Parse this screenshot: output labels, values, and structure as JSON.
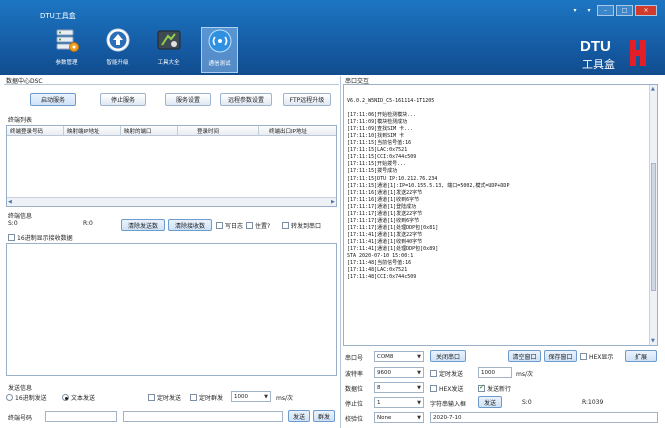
{
  "window": {
    "title": "DTU工具盒",
    "controls": [
      "▾",
      "▾",
      "–",
      "□",
      "×"
    ]
  },
  "nav": [
    {
      "label": "参数管理",
      "icon": "server-config-icon"
    },
    {
      "label": "智能升级",
      "icon": "upload-arrow-icon"
    },
    {
      "label": "工具大全",
      "icon": "toolbox-icon"
    },
    {
      "label": "通信测试",
      "icon": "signal-test-icon"
    }
  ],
  "logo": {
    "line1": "DTU",
    "line2": "工具盒"
  },
  "left": {
    "title": "数据中心DSC",
    "buttons": [
      "启动服务",
      "停止服务",
      "服务设置",
      "远程参数设置",
      "FTP远程升级"
    ],
    "list_title": "终端列表",
    "columns": [
      "终端登录号码",
      "映射端IP地址",
      "映射的端口",
      "登录时间",
      "终端出口IP地址"
    ],
    "info_title": "终端信息",
    "s_label": "S:0",
    "r_label": "R:0",
    "clear_send": "清除发送数",
    "clear_recv": "清除接收数",
    "opt_log": "写日志",
    "opt_top": "住置?",
    "opt_forward": "转发到串口",
    "opt_hex_recv": "16进制显示接收数据",
    "send_title": "发送信息",
    "radio_hex": "16进制发送",
    "radio_text": "文本发送",
    "opt_timed": "定时发送",
    "opt_timed_group": "定时群发",
    "interval": "1000",
    "interval_unit": "ms/次",
    "terminal_label": "终端号码",
    "send": "发送",
    "group_send": "群发"
  },
  "right": {
    "title": "串口交互",
    "log": [
      "V6.0.2_W5NID_C5-161114-1T1205",
      "",
      "[17:11:06]开始检测模块...",
      "[17:11:09]模块检测成功",
      "[17:11:09]查找SIM 卡...",
      "[17:11:10]找到SIM 卡",
      "[17:11:15]当前信号值:16",
      "[17:11:15]LAC:0x7521",
      "[17:11:15]CCI:0x744c509",
      "[17:11:15]开始拨号...",
      "[17:11:15]拨号成功",
      "[17:11:15]DTU IP:10.212.76.234",
      "[17:11:15]通道[1]:IP=10.155.5.13, 端口=5002,模式=UDP+DDP",
      "[17:11:16]通道[1]发送22字节",
      "[17:11:16]通道[1]收到6字节",
      "[17:11:17]通道[1]登陆成功",
      "[17:11:17]通道[1]发送22字节",
      "[17:11:17]通道[1]收到6字节",
      "[17:11:17]通道[1]处理DDP包[0x81]",
      "[17:11:41]通道[1]发送22字节",
      "[17:11:41]通道[1]收到40字节",
      "[17:11:41]通道[1]处理DDP包[0x89]",
      "STA 2020-07-10 15:00:1",
      "[17:11:48]当前信号值:16",
      "[17:11:48]LAC:0x7521",
      "[17:11:48]CCI:0x744c509"
    ],
    "port_label": "串口号",
    "port_value": "COM8",
    "close_port": "关闭串口",
    "clear_window": "清空窗口",
    "save_window": "保存窗口",
    "hex_display": "HEX显示",
    "expand": "扩展",
    "baud_label": "波特率",
    "baud_value": "9600",
    "timed_send": "定时发送",
    "timed_ms": "1000",
    "timed_unit": "ms/次",
    "data_bits_label": "数据位",
    "data_bits_value": "8",
    "hex_send": "HEX发送",
    "send_newline": "发送新行",
    "stop_bits_label": "停止位",
    "stop_bits_value": "1",
    "input_box": "字符串输入框",
    "send": "发送",
    "s_count": "S:0",
    "r_count": "R:1039",
    "parity_label": "校验位",
    "parity_value": "None",
    "input_value": "2020-7-10"
  }
}
